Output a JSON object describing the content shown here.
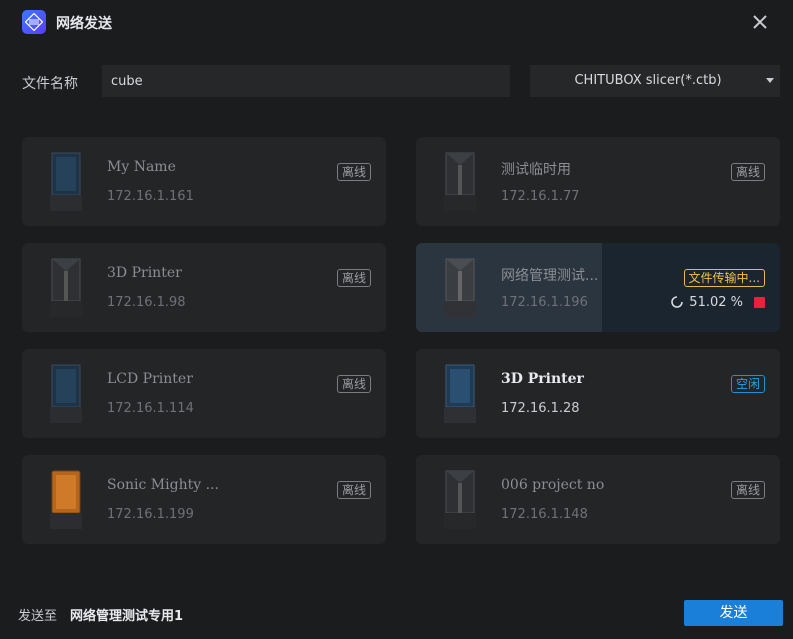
{
  "window": {
    "title": "网络发送"
  },
  "file": {
    "label": "文件名称",
    "name_value": "cube",
    "format_selected": "CHITUBOX slicer(*.ctb)"
  },
  "printers": [
    {
      "name": "My Name",
      "ip": "172.16.1.161",
      "status": "离线",
      "state": "offline",
      "model_icon": "dark-printer-icon"
    },
    {
      "name": "测试临时用",
      "ip": "172.16.1.77",
      "status": "离线",
      "state": "offline",
      "model_icon": "gray-printer-icon"
    },
    {
      "name": "3D Printer",
      "ip": "172.16.1.98",
      "status": "离线",
      "state": "offline",
      "model_icon": "gray-printer-icon"
    },
    {
      "name": "网络管理测试...",
      "ip": "172.16.1.196",
      "status": "文件传输中...",
      "state": "transferring",
      "progress": "51.02 %",
      "model_icon": "gray-printer-icon"
    },
    {
      "name": "LCD Printer",
      "ip": "172.16.1.114",
      "status": "离线",
      "state": "offline",
      "model_icon": "dark-printer-icon"
    },
    {
      "name": "3D Printer",
      "ip": "172.16.1.28",
      "status": "空闲",
      "state": "online",
      "model_icon": "dark-printer-icon"
    },
    {
      "name": "Sonic Mighty ...",
      "ip": "172.16.1.199",
      "status": "离线",
      "state": "offline",
      "model_icon": "orange-printer-icon"
    },
    {
      "name": "006 project no",
      "ip": "172.16.1.148",
      "status": "离线",
      "state": "offline",
      "model_icon": "gray-printer-icon"
    }
  ],
  "footer": {
    "send_to_label": "发送至",
    "send_to_value": "网络管理测试专用1",
    "send_label": "发送"
  },
  "colors": {
    "accent": "#1a7fd8",
    "online": "#2aa0e8",
    "transferring": "#f0c14b",
    "stop": "#e5233b"
  }
}
